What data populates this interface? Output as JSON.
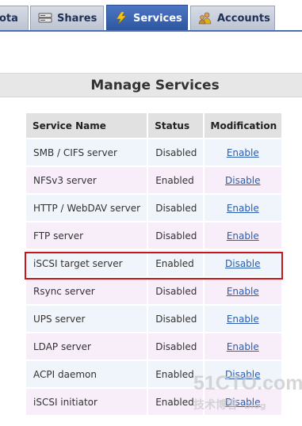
{
  "nav": {
    "tabs": [
      {
        "label": "ota",
        "icon": "quota-icon",
        "active": false
      },
      {
        "label": "Shares",
        "icon": "shares-icon",
        "active": false
      },
      {
        "label": "Services",
        "icon": "lightning-icon",
        "active": true
      },
      {
        "label": "Accounts",
        "icon": "accounts-icon",
        "active": false
      }
    ]
  },
  "page": {
    "title": "Manage Services"
  },
  "table": {
    "headers": {
      "name": "Service Name",
      "status": "Status",
      "modification": "Modification"
    },
    "rows": [
      {
        "name": "SMB / CIFS server",
        "status": "Disabled",
        "action": "Enable"
      },
      {
        "name": "NFSv3 server",
        "status": "Enabled",
        "action": "Disable"
      },
      {
        "name": "HTTP / WebDAV server",
        "status": "Disabled",
        "action": "Enable"
      },
      {
        "name": "FTP server",
        "status": "Disabled",
        "action": "Enable"
      },
      {
        "name": "iSCSI target server",
        "status": "Enabled",
        "action": "Disable",
        "highlighted": true
      },
      {
        "name": "Rsync server",
        "status": "Disabled",
        "action": "Enable"
      },
      {
        "name": "UPS server",
        "status": "Disabled",
        "action": "Enable"
      },
      {
        "name": "LDAP server",
        "status": "Disabled",
        "action": "Enable"
      },
      {
        "name": "ACPI daemon",
        "status": "Enabled",
        "action": "Disable"
      },
      {
        "name": "iSCSI initiator",
        "status": "Enabled",
        "action": "Disable"
      }
    ]
  },
  "watermark": {
    "main": "51CTO.com",
    "sub": "技术博客",
    "blog": "Blog"
  },
  "colors": {
    "active_tab": "#3a64b3",
    "tab_bar_line": "#4a6fb5",
    "highlight": "#c8161d",
    "link": "#2a5db0"
  }
}
